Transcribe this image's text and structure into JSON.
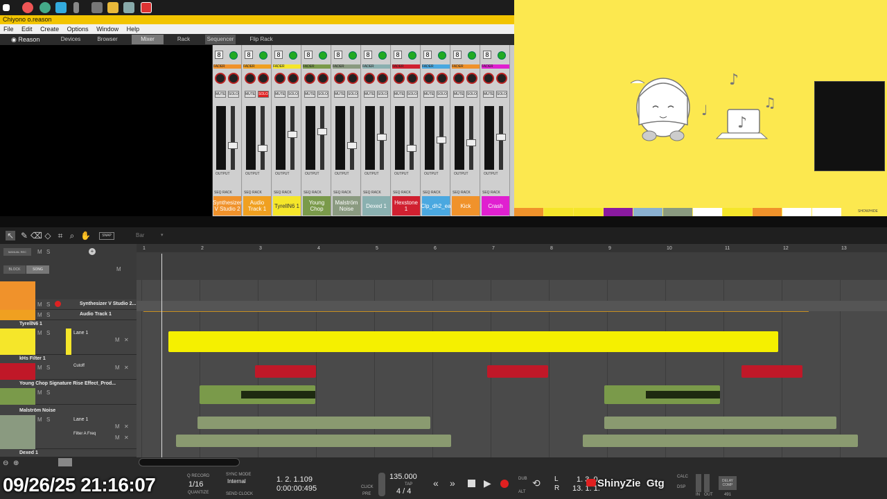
{
  "window": {
    "title": "Chiyono o.reason"
  },
  "menu": [
    "File",
    "Edit",
    "Create",
    "Options",
    "Window",
    "Help"
  ],
  "app_tabs": {
    "brand": "Reason",
    "tabs": [
      "Devices",
      "Browser",
      "Mixer",
      "Rack",
      "Sequencer",
      "Flip Rack"
    ],
    "active": "Mixer"
  },
  "mixer": {
    "fader_label": "FADER",
    "mute": "MUTE",
    "solo": "SOLO",
    "output": "OUTPUT",
    "seq": "SEQ",
    "rack": "RACK",
    "channels": [
      {
        "num": "8",
        "name": "Synthesizer V Studio 2",
        "color": "#f0922b",
        "fader": 0.35,
        "solo_active": false
      },
      {
        "num": "8",
        "name": "Audio Track 1",
        "color": "#f0a020",
        "fader": 0.3,
        "solo_active": true
      },
      {
        "num": "8",
        "name": "TyrellN6 1",
        "color": "#f5e62a",
        "fader": 0.55,
        "solo_active": false
      },
      {
        "num": "8",
        "name": "Young Chop",
        "color": "#7a9a4a",
        "fader": 0.6,
        "solo_active": false
      },
      {
        "num": "8",
        "name": "Malström Noise",
        "color": "#8a9a80",
        "fader": 0.35,
        "solo_active": false
      },
      {
        "num": "8",
        "name": "Dexed 1",
        "color": "#8ab0b0",
        "fader": 0.5,
        "solo_active": false
      },
      {
        "num": "8",
        "name": "Hexstone 1",
        "color": "#d02030",
        "fader": 0.3,
        "solo_active": false
      },
      {
        "num": "8",
        "name": "Clp_dh2_ea",
        "color": "#4aa8e0",
        "fader": 0.45,
        "solo_active": false
      },
      {
        "num": "8",
        "name": "Kick",
        "color": "#f0922b",
        "fader": 0.4,
        "solo_active": false
      },
      {
        "num": "8",
        "name": "Crash",
        "color": "#e020d0",
        "fader": 0.5,
        "solo_active": false
      }
    ]
  },
  "stream_overlay": {
    "strip_colors": [
      "#f0922b",
      "#f5e62a",
      "#f5e62a",
      "#8a1aa0",
      "#8ab0d0",
      "#8a9a80",
      "#ffffff",
      "#f5e62a",
      "#f0922b",
      "#ffffff",
      "#ffffff"
    ],
    "show_hide": "SHOW/HIDE"
  },
  "toolbar": {
    "snap": "SNAP",
    "snap_value": "Bar"
  },
  "track_header": {
    "manual_rec": "MANUAL REC",
    "m": "M",
    "s": "S",
    "block": "BLOCK",
    "song": "SONG",
    "tracks": [
      {
        "name": "Synthesizer V Studio 2...",
        "color": "#f0922b"
      },
      {
        "name": "Audio Track 1",
        "color": "#f0a020"
      },
      {
        "name": "TyrellN6 1",
        "color": "#f5e62a",
        "lane": "Lane 1"
      },
      {
        "name": "kHs Filter 1",
        "color": "#c01828",
        "lane": "Cutoff"
      },
      {
        "name": "Young Chop Signature Rise Effect_Prod...",
        "color": "#7a9a4a"
      },
      {
        "name": "Malström Noise",
        "color": "#8a9a80",
        "lane": "Lane 1",
        "lane2": "Filter A Freq"
      },
      {
        "name": "Dexed 1",
        "color": "#8ab0b0"
      }
    ]
  },
  "ruler": [
    "1",
    "2",
    "3",
    "4",
    "5",
    "6",
    "7",
    "8",
    "9",
    "10",
    "11",
    "12",
    "13"
  ],
  "transport": {
    "clock": "09/26/25 21:16:07",
    "q_record": "Q RECORD",
    "quantize_val": "1/16",
    "quantize": "QUANTIZE",
    "sync_mode": "SYNC MODE",
    "sync_val": "Internal",
    "send_clock": "SEND CLOCK",
    "position": "1. 2. 1.109",
    "time": "0:00:00:495",
    "click": "CLICK",
    "pre": "PRE",
    "tempo": "135.000",
    "tap": "TAP",
    "signature": "4 / 4",
    "dub": "DUB",
    "alt": "ALT",
    "loop_l": "L",
    "loop_r": "R",
    "loop_l_val": "1. 3. 0.",
    "loop_r_val": "13. 1. 1.",
    "watermark": "ShinyZie  Gtg",
    "calc": "CALC",
    "dsp": "DSP",
    "in": "IN",
    "out": "OUT",
    "delay_comp": "DELAY COMP",
    "delay_val": "491"
  }
}
